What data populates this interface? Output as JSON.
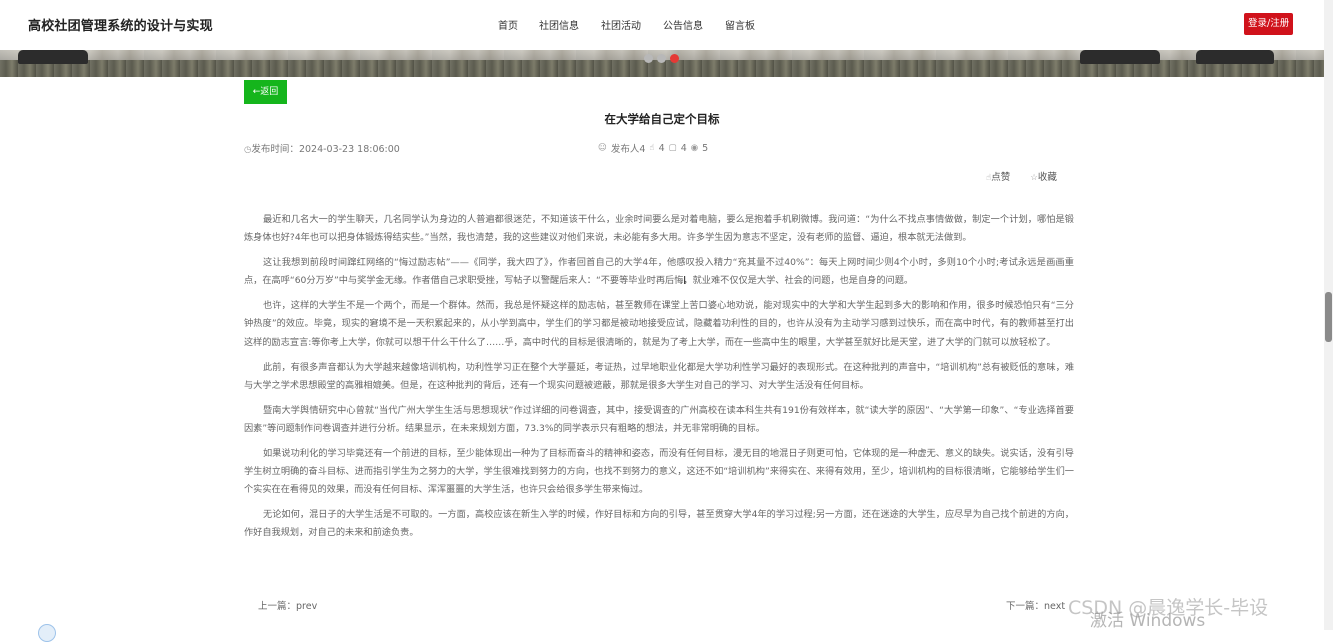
{
  "header": {
    "site_title": "高校社团管理系统的设计与实现",
    "nav": [
      "首页",
      "社团信息",
      "社团活动",
      "公告信息",
      "留言板"
    ],
    "login_label": "登录/注册"
  },
  "banner": {
    "dots": 3,
    "active_dot": 3
  },
  "colors": {
    "login_button": "#d0121b",
    "back_button": "#15b51c",
    "active_dot": "#e53935"
  },
  "article": {
    "back_label": "返回",
    "title": "在大学给自己定个目标",
    "publish_time_label": "发布时间：",
    "publish_time": "2024-03-23 18:06:00",
    "author": "发布人4",
    "likes": "4",
    "comments": "4",
    "views": "5",
    "like_label": "点赞",
    "favorite_label": "收藏",
    "paragraphs": [
      "最近和几名大一的学生聊天，几名同学认为身边的人普遍都很迷茫，不知道该干什么，业余时间要么是对着电脑，要么是抱着手机刷微博。我问道：“为什么不找点事情做做，制定一个计划，哪怕是锻炼身体也好?4年也可以把身体锻炼得结实些。”当然，我也清楚，我的这些建议对他们来说，未必能有多大用。许多学生因为意志不坚定，没有老师的监督、逼迫，根本就无法做到。",
      "这让我想到前段时间蹿红网络的“悔过励志帖”——《同学，我大四了》，作者回首自己的大学4年，他感叹投入精力“充其量不过40%”：每天上网时间少则4个小时，多则10个小时;考试永远是画画重点，在高呼“60分万岁”中与奖学金无缘。作者借自己求职受挫，写帖子以警醒后来人：“不要等毕业时再后悔，就业难不仅仅是大学、社会的问题，也是自身的问题。",
      "也许，这样的大学生不是一个两个，而是一个群体。然而，我总是怀疑这样的励志帖，甚至教师在课堂上苦口婆心地劝说，能对现实中的大学和大学生起到多大的影响和作用，很多时候恐怕只有“三分钟热度”的效应。毕竟，现实的窘境不是一天积累起来的，从小学到高中，学生们的学习都是被动地接受应试，隐藏着功利性的目的，也许从没有为主动学习感到过快乐，而在高中时代，有的教师甚至打出这样的励志宣言:等你考上大学，你就可以想干什么干什么了……乎，高中时代的目标是很清晰的，就是为了考上大学，而在一些高中生的眼里，大学甚至就好比是天堂，进了大学的门就可以放轻松了。",
      "此前，有很多声音都认为大学越来越像培训机构，功利性学习正在整个大学蔓延，考证热，过早地职业化都是大学功利性学习最好的表现形式。在这种批判的声音中，“培训机构”总有被贬低的意味，难与大学之学术思想殿堂的高雅相媲美。但是，在这种批判的背后，还有一个现实问题被遮蔽，那就是很多大学生对自己的学习、对大学生活没有任何目标。",
      "暨南大学舆情研究中心曾就“当代广州大学生生活与思想现状”作过详细的问卷调查，其中，接受调查的广州高校在读本科生共有191份有效样本，就“读大学的原因”、“大学第一印象”、“专业选择首要因素”等问题制作问卷调查并进行分析。结果显示，在未来规划方面，73.3%的同学表示只有粗略的想法，并无非常明确的目标。",
      "如果说功利化的学习毕竟还有一个前进的目标，至少能体现出一种为了目标而奋斗的精神和姿态，而没有任何目标，漫无目的地混日子则更可怕，它体现的是一种虚无、意义的缺失。说实话，没有引导学生树立明确的奋斗目标、进而指引学生为之努力的大学，学生很难找到努力的方向，也找不到努力的意义，这还不如“培训机构”来得实在、来得有效用，至少，培训机构的目标很清晰，它能够给学生们一个实实在在看得见的效果，而没有任何目标、浑浑噩噩的大学生活，也许只会给很多学生带来悔过。",
      "无论如何，混日子的大学生活是不可取的。一方面，高校应该在新生入学的时候，作好目标和方向的引导，甚至贯穿大学4年的学习过程;另一方面，还在迷途的大学生，应尽早为自己找个前进的方向，作好自我规划，对自己的未来和前途负责。"
    ],
    "prev_label": "上一篇：",
    "prev_title": "prev",
    "next_label": "下一篇：",
    "next_title": "next"
  },
  "overlay": {
    "watermark": "CSDN @晨逸学长-毕设",
    "activate_windows": "激活 Windows"
  }
}
